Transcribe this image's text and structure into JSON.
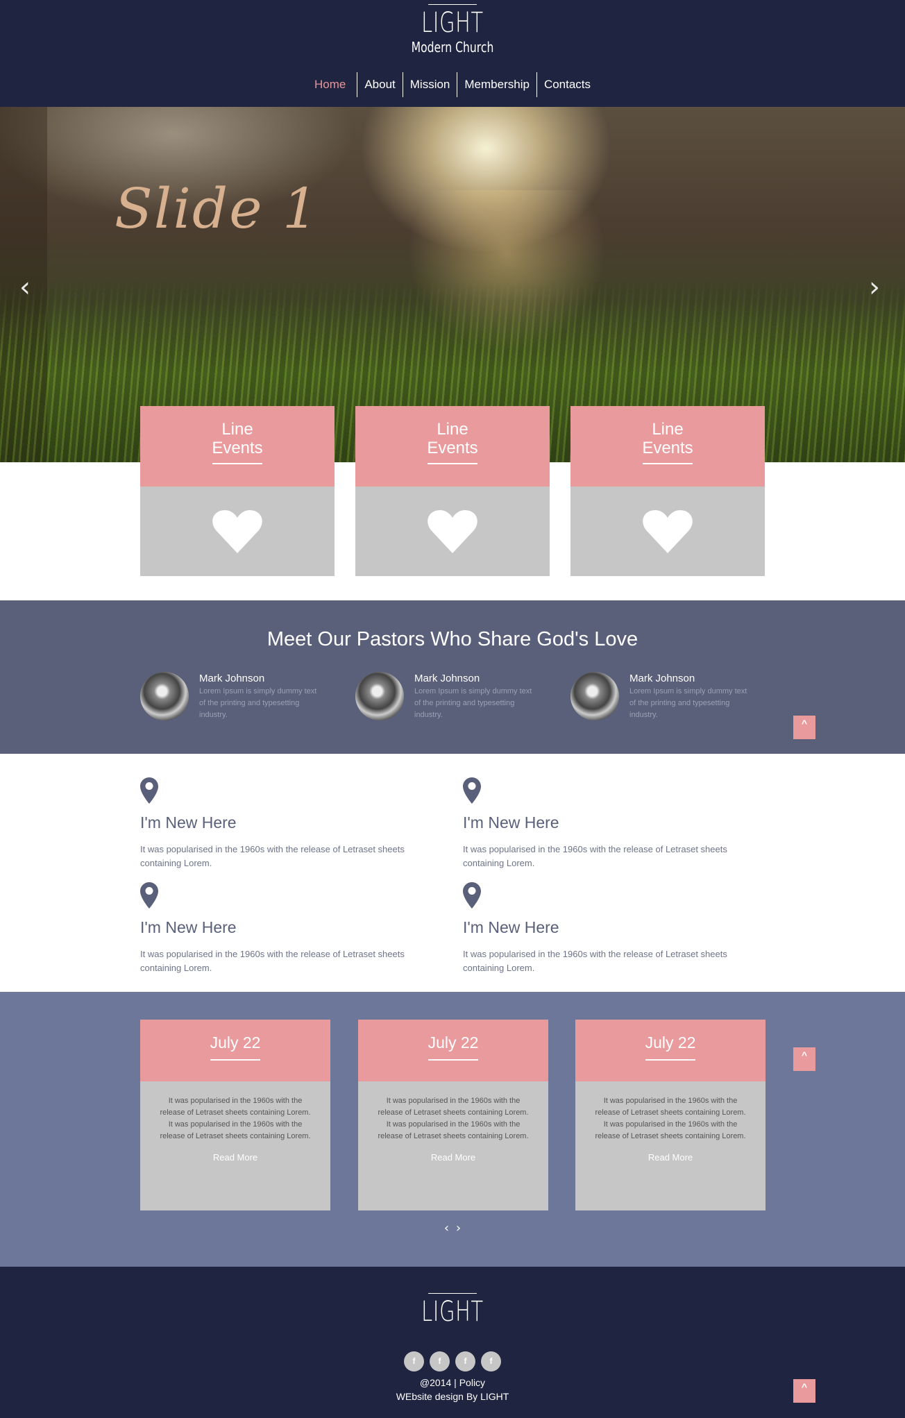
{
  "header": {
    "logo_title": "LIGHT",
    "logo_subtitle": "Modern Church",
    "nav": [
      "Home",
      "About",
      "Mission",
      "Membership",
      "Contacts"
    ],
    "active_nav": "Home"
  },
  "slider": {
    "title": "Slide 1",
    "prev_icon": "chevron-left-icon",
    "next_icon": "chevron-right-icon"
  },
  "event_cards": [
    {
      "title_line1": "Line",
      "title_line2": "Events",
      "icon": "heart-icon"
    },
    {
      "title_line1": "Line",
      "title_line2": "Events",
      "icon": "heart-icon"
    },
    {
      "title_line1": "Line",
      "title_line2": "Events",
      "icon": "heart-icon"
    }
  ],
  "pastors": {
    "heading": "Meet Our Pastors Who Share God's Love",
    "items": [
      {
        "name": "Mark Johnson",
        "desc": "Lorem Ipsum is simply dummy text of the printing and typesetting industry."
      },
      {
        "name": "Mark Johnson",
        "desc": "Lorem Ipsum is simply dummy text of the printing and typesetting industry."
      },
      {
        "name": "Mark Johnson",
        "desc": "Lorem Ipsum is simply dummy text of the printing and typesetting industry."
      }
    ]
  },
  "features": [
    {
      "title": "I'm New Here",
      "text": "It was popularised in the 1960s with the release of Letraset sheets containing Lorem.",
      "icon": "map-pin-icon"
    },
    {
      "title": "I'm New Here",
      "text": "It was popularised in the 1960s with the release of Letraset sheets containing Lorem.",
      "icon": "map-pin-icon"
    },
    {
      "title": "I'm New Here",
      "text": "It was popularised in the 1960s with the release of Letraset sheets containing Lorem.",
      "icon": "map-pin-icon"
    },
    {
      "title": "I'm New Here",
      "text": "It was popularised in the 1960s with the release of Letraset sheets containing Lorem.",
      "icon": "map-pin-icon"
    }
  ],
  "dates": {
    "items": [
      {
        "date": "July 22",
        "p1": "It was popularised in the 1960s with the release of Letraset sheets containing Lorem.",
        "p2": "It was popularised in the 1960s with the release of Letraset sheets containing Lorem.",
        "link": "Read More"
      },
      {
        "date": "July 22",
        "p1": "It was popularised in the 1960s with the release of Letraset sheets containing Lorem.",
        "p2": "It was popularised in the 1960s with the release of Letraset sheets containing Lorem.",
        "link": "Read More"
      },
      {
        "date": "July 22",
        "p1": "It was popularised in the 1960s with the release of Letraset sheets containing Lorem.",
        "p2": "It was popularised in the 1960s with the release of Letraset sheets containing Lorem.",
        "link": "Read More"
      }
    ],
    "prev": "‹",
    "next": "›"
  },
  "back_to_top": "^",
  "footer": {
    "logo": "LIGHT",
    "socials": [
      "f",
      "f",
      "f",
      "f"
    ],
    "copyright_prefix": "@2014 | ",
    "policy": "Policy",
    "credit": "WEbsite design By LIGHT"
  },
  "colors": {
    "navy": "#1f2440",
    "pink": "#e99a9c",
    "slate": "#5a6079",
    "periwinkle": "#6d7799",
    "card_gray": "#c6c6c6"
  }
}
